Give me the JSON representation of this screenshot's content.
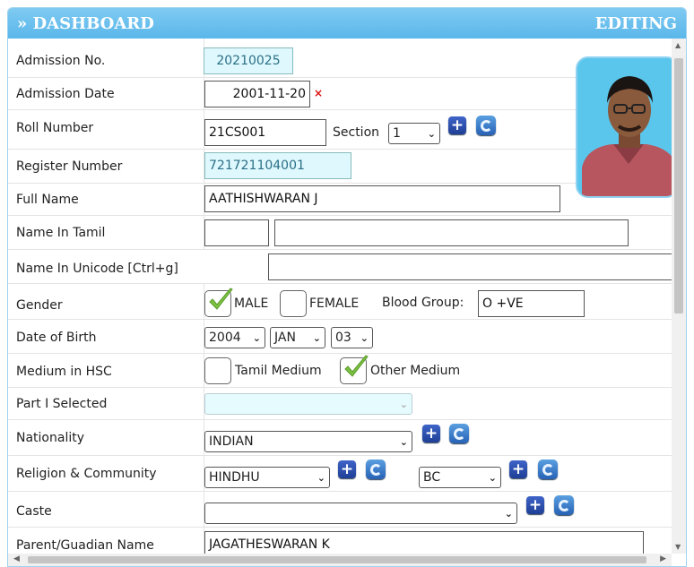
{
  "header": {
    "title": "» DASHBOARD",
    "status": "EDITING"
  },
  "labels": {
    "admission_no": "Admission No.",
    "admission_date": "Admission Date",
    "roll_number": "Roll Number",
    "register_number": "Register Number",
    "full_name": "Full Name",
    "name_tamil": "Name In Tamil",
    "name_unicode": "Name In Unicode [Ctrl+g]",
    "gender": "Gender",
    "dob": "Date of Birth",
    "medium_hsc": "Medium in HSC",
    "part1": "Part I Selected",
    "nationality": "Nationality",
    "religion_community": "Religion & Community",
    "caste": "Caste",
    "parent": "Parent/Guadian Name",
    "section": "Section",
    "blood_group": "Blood Group:"
  },
  "values": {
    "admission_no": "20210025",
    "admission_date": "2001-11-20",
    "admission_date_required": "×",
    "roll_number": "21CS001",
    "section": "1",
    "register_number": "721721104001",
    "full_name": "AATHISHWARAN J",
    "name_tamil_1": "",
    "name_tamil_2": "",
    "name_unicode": "",
    "blood_group": "O +VE",
    "dob_year": "2004",
    "dob_month": "JAN",
    "dob_day": "03",
    "part1": "",
    "nationality": "INDIAN",
    "religion": "HINDHU",
    "community": "BC",
    "caste": "",
    "parent": "JAGATHESWARAN K"
  },
  "gender_options": {
    "male": "MALE",
    "female": "FEMALE",
    "selected": "MALE"
  },
  "medium_options": {
    "tamil": "Tamil Medium",
    "other": "Other Medium",
    "selected": "Other Medium"
  },
  "icons": {
    "add": "plus-icon",
    "refresh": "refresh-icon",
    "check": "checkmark-icon"
  },
  "colors": {
    "header": "#5ab7ea",
    "cyan_field": "#dff8fd",
    "add_button": "#2a4fb0",
    "check": "#7cc242"
  }
}
